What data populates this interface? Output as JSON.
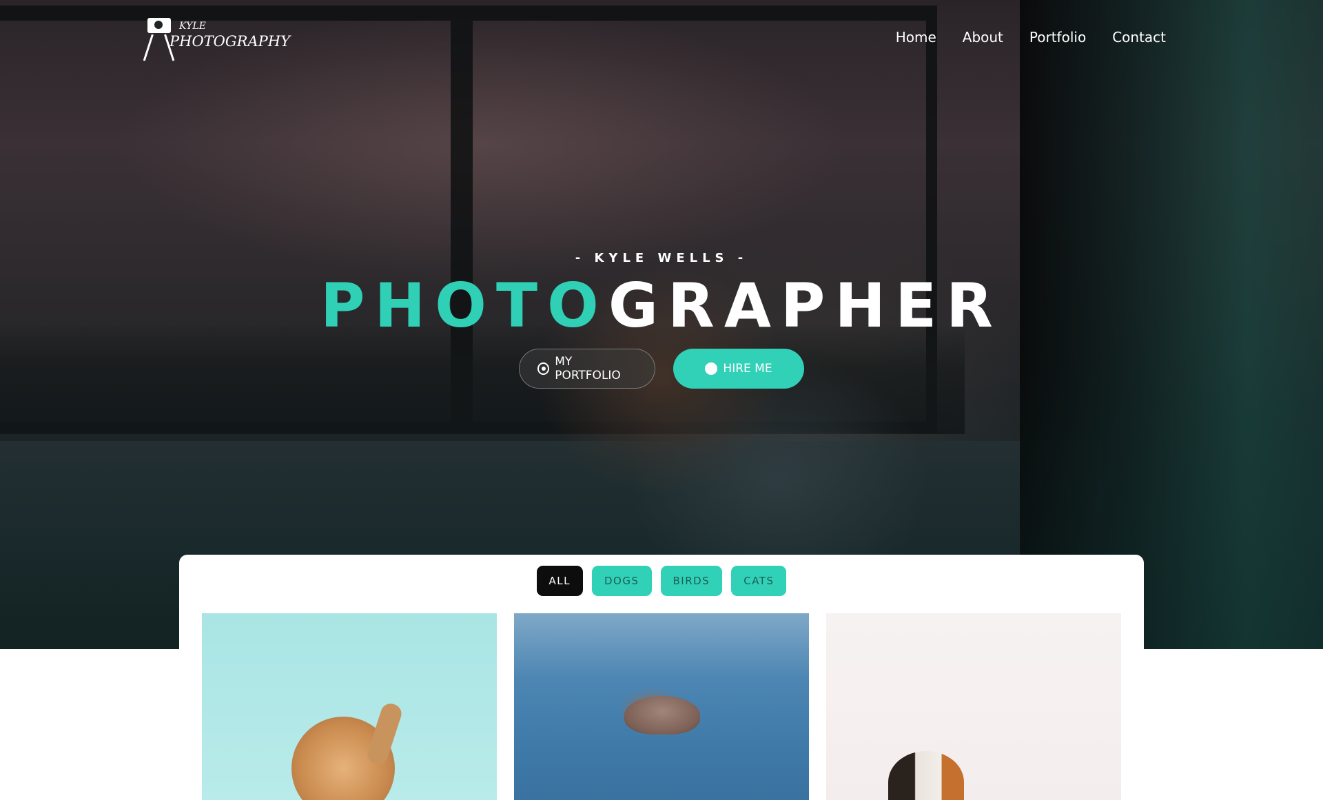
{
  "brand": {
    "top": "KYLE",
    "main": "PHOTOGRAPHY"
  },
  "nav": {
    "items": [
      "Home",
      "About",
      "Portfolio",
      "Contact"
    ]
  },
  "hero": {
    "subtitle": "- KYLE WELLS -",
    "headline_part1": "PHOTO",
    "headline_part2": "GRAPHER",
    "buttons": {
      "portfolio": "MY PORTFOLIO",
      "hire": "HIRE ME"
    }
  },
  "filters": {
    "items": [
      "ALL",
      "DOGS",
      "BIRDS",
      "CATS"
    ],
    "active": "ALL"
  },
  "colors": {
    "accent": "#31d1b8",
    "dark": "#0d0d0d",
    "white": "#ffffff"
  },
  "icons": {
    "portfolio_button": "target-icon",
    "hire_button": "circle-icon",
    "logo": "camera-tripod-icon"
  }
}
